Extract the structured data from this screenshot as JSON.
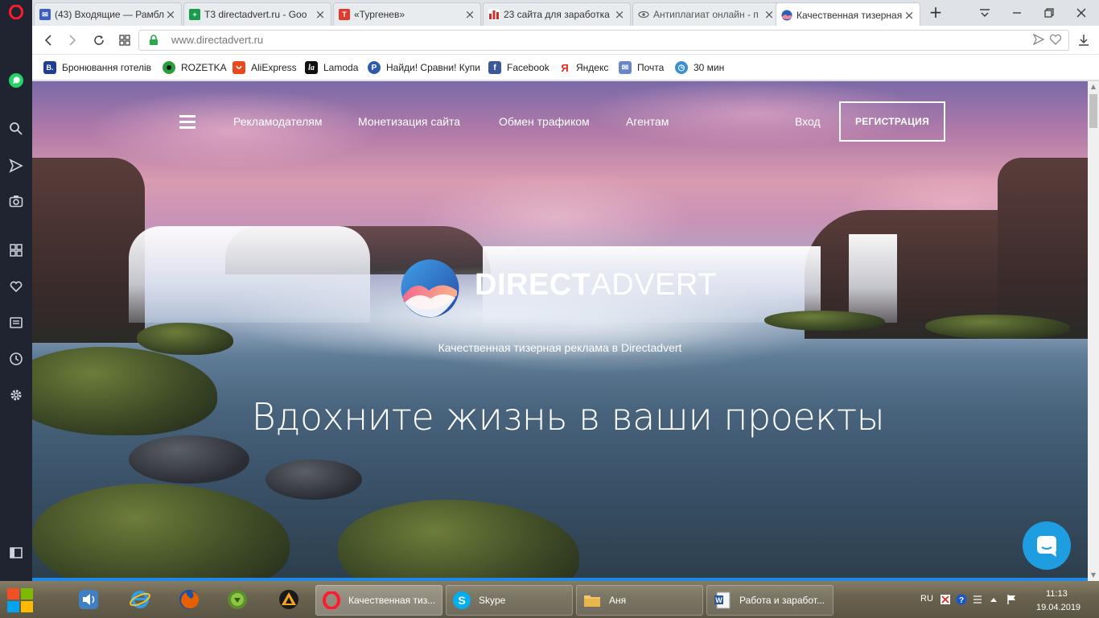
{
  "browser": {
    "tabs": [
      {
        "title": "(43) Входящие — Рамбл",
        "favicon_color": "#3b5fc4"
      },
      {
        "title": "Т3 directadvert.ru - Goo",
        "favicon_color": "#1a9b4b"
      },
      {
        "title": "«Тургенев»",
        "favicon_color": "#e23a2e"
      },
      {
        "title": "23 сайта для заработка",
        "favicon_color": "#d62b2b"
      },
      {
        "title": "Антиплагиат онлайн - п",
        "favicon_color": "#777777"
      },
      {
        "title": "Качественная тизерная",
        "favicon_color": "#3a6ec9",
        "active": true
      }
    ],
    "url": "www.directadvert.ru"
  },
  "bookmarks": [
    {
      "label": "Бронювання готелів",
      "icon": "booking-icon",
      "color": "#1f3f8f",
      "glyph": "B."
    },
    {
      "label": "ROZETKA",
      "icon": "rozetka-icon",
      "color": "#2a9d3c",
      "glyph": ""
    },
    {
      "label": "AliExpress",
      "icon": "aliexpress-icon",
      "color": "#e8491d",
      "glyph": ""
    },
    {
      "label": "Lamoda",
      "icon": "lamoda-icon",
      "color": "#111111",
      "glyph": "la"
    },
    {
      "label": "Найди! Сравни! Купи",
      "icon": "price-icon",
      "color": "#2f5aa6",
      "glyph": "P"
    },
    {
      "label": "Facebook",
      "icon": "facebook-icon",
      "color": "#3b5998",
      "glyph": "f"
    },
    {
      "label": "Яндекс",
      "icon": "yandex-icon",
      "color": "#ffffff",
      "glyph": "Я"
    },
    {
      "label": "Почта",
      "icon": "mail-icon",
      "color": "#6a86c8",
      "glyph": "✉"
    },
    {
      "label": "30 мин",
      "icon": "timer-icon",
      "color": "#3a8fd0",
      "glyph": "◷"
    }
  ],
  "site": {
    "nav": {
      "advertisers": "Рекламодателям",
      "monetization": "Монетизация сайта",
      "traffic_exchange": "Обмен трафиком",
      "agents": "Агентам",
      "login": "Вход",
      "register": "РЕГИСТРАЦИЯ"
    },
    "logo_bold": "DIRECT",
    "logo_light": "ADVERT",
    "tagline": "Качественная тизерная реклама в Directadvert",
    "headline": "Вдохните жизнь в ваши проекты"
  },
  "taskbar": {
    "buttons": [
      {
        "label": "Качественная тиз...",
        "icon": "opera-icon",
        "active": true
      },
      {
        "label": "Skype",
        "icon": "skype-icon"
      },
      {
        "label": "Аня",
        "icon": "folder-icon"
      },
      {
        "label": "Работа и заработ...",
        "icon": "word-icon"
      }
    ],
    "language": "RU",
    "time": "11:13",
    "date": "19.04.2019"
  }
}
